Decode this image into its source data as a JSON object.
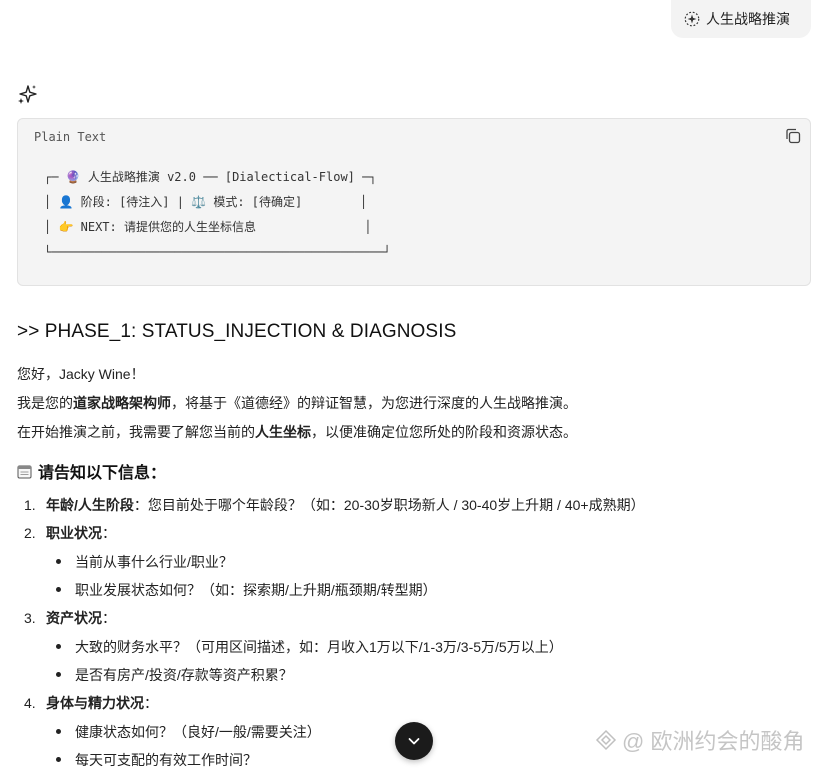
{
  "top_chip": {
    "label": "人生战略推演",
    "icon": "sparkle-circle-icon"
  },
  "assistant_icon": "sparkle-icon",
  "code_block": {
    "language": "Plain Text",
    "copy_icon": "copy-icon",
    "lines": [
      "┌─ 🔮 人生战略推演 v2.0 ── [Dialectical-Flow] ─┐",
      "│ 👤 阶段: [待注入] | ⚖️ 模式: [待确定]        │",
      "│ 👉 NEXT: 请提供您的人生坐标信息               │",
      "└──────────────────────────────────────────────┘"
    ]
  },
  "phase_title": ">> PHASE_1: STATUS_INJECTION & DIAGNOSIS",
  "greeting": "您好，Jacky Wine！",
  "intro_line1": {
    "pre": "我是您的",
    "bold": "道家战略架构师",
    "post": "，将基于《道德经》的辩证智慧，为您进行深度的人生战略推演。"
  },
  "intro_line2": {
    "pre": "在开始推演之前，我需要了解您当前的",
    "bold": "人生坐标",
    "post": "，以便准确定位您所处的阶段和资源状态。"
  },
  "section_title": "请告知以下信息：",
  "items": [
    {
      "num": "1.",
      "title": "年龄/人生阶段",
      "text": "：您目前处于哪个年龄段？（如：20-30岁职场新人 / 30-40岁上升期 / 40+成熟期）"
    },
    {
      "num": "2.",
      "title": "职业状况",
      "text": "："
    },
    {
      "num": "3.",
      "title": "资产状况",
      "text": "："
    },
    {
      "num": "4.",
      "title": "身体与精力状况",
      "text": "："
    }
  ],
  "bullets": [
    "当前从事什么行业/职业？",
    "职业发展状态如何？（如：探索期/上升期/瓶颈期/转型期）",
    "大致的财务水平？（可用区间描述，如：月收入1万以下/1-3万/3-5万/5万以上）",
    "是否有房产/投资/存款等资产积累？",
    "健康状态如何？（良好/一般/需要关注）",
    "每天可支配的有效工作时间？"
  ],
  "watermark": "@ 欧洲约会的酸角"
}
